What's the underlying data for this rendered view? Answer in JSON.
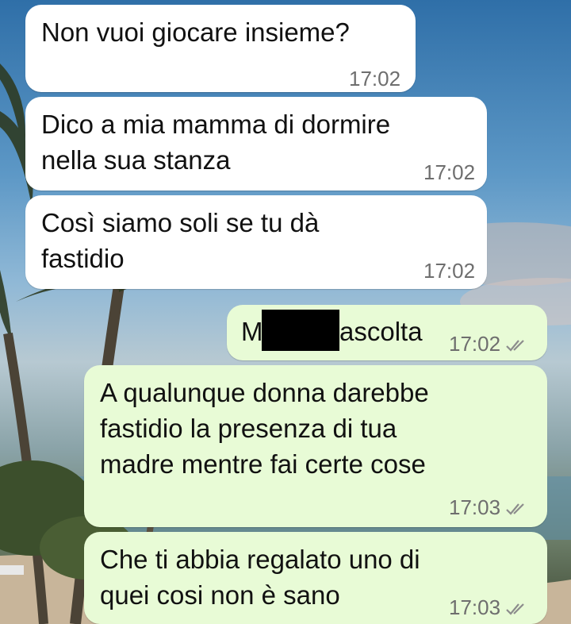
{
  "messages": [
    {
      "direction": "incoming",
      "text": "Non vuoi giocare insieme?",
      "time": "17:02"
    },
    {
      "direction": "incoming",
      "text": "Dico a mia mamma di dormire\nnella sua stanza",
      "time": "17:02"
    },
    {
      "direction": "incoming",
      "text": "Così siamo soli se tu dà\nfastidio",
      "time": "17:02"
    },
    {
      "direction": "outgoing",
      "text_start": "M",
      "text_end": "ascolta",
      "time": "17:02",
      "status": "read"
    },
    {
      "direction": "outgoing",
      "text": "A qualunque donna darebbe\nfastidio la presenza di tua\nmadre mentre fai certe cose",
      "time": "17:03",
      "status": "read"
    },
    {
      "direction": "outgoing",
      "text": "Che ti abbia regalato uno di\nquei cosi non è sano",
      "time": "17:03",
      "status": "read"
    }
  ],
  "colors": {
    "incoming_bubble": "#ffffff",
    "outgoing_bubble": "#e8fbd6",
    "timestamp": "#6e6e6e",
    "read_check": "#8c8c8c"
  },
  "icons": {
    "read_status": "double-check-icon"
  }
}
